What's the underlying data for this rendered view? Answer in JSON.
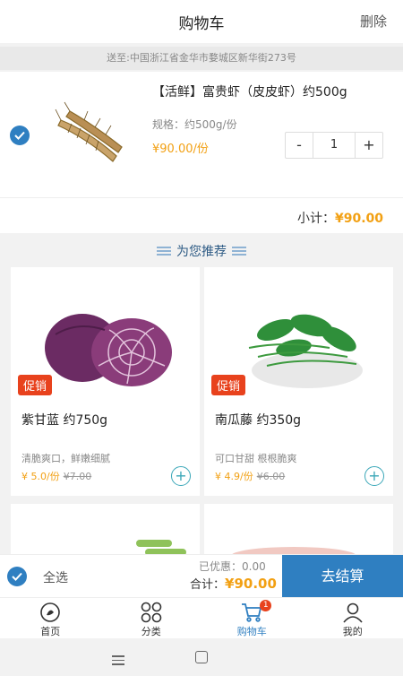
{
  "header": {
    "title": "购物车",
    "delete_label": "删除"
  },
  "address": {
    "text": "送至:中国浙江省金华市婺城区新华街273号"
  },
  "cart_item": {
    "checked": true,
    "name": "【活鲜】富贵虾（皮皮虾）约500g",
    "spec": "规格：约500g/份",
    "price": "¥90.00/份",
    "quantity": "1",
    "minus_label": "-",
    "plus_label": "+",
    "subtotal_label": "小计：",
    "subtotal_value": "¥90.00"
  },
  "recommend": {
    "title": "为您推荐",
    "products": [
      {
        "badge": "促销",
        "name": "紫甘蓝  约750g",
        "desc": "清脆爽口，鲜嫩细腻",
        "price": "¥ 5.0/份",
        "old_price": "¥7.00",
        "add_label": "+"
      },
      {
        "badge": "促销",
        "name": "南瓜藤 约350g",
        "desc": "可口甘甜 根根脆爽",
        "price": "¥ 4.9/份",
        "old_price": "¥6.00",
        "add_label": "+"
      }
    ]
  },
  "bottom_bar": {
    "select_all_label": "全选",
    "discount_text": "已优惠：0.00",
    "total_label": "合计：",
    "total_value": "¥90.00",
    "checkout_label": "去结算"
  },
  "tabbar": {
    "items": [
      {
        "label": "首页",
        "icon": "home-icon"
      },
      {
        "label": "分类",
        "icon": "category-icon"
      },
      {
        "label": "购物车",
        "icon": "cart-icon",
        "badge": "1"
      },
      {
        "label": "我的",
        "icon": "profile-icon"
      }
    ]
  },
  "colors": {
    "accent": "#2f7fc1",
    "price": "#f2a013",
    "promo": "#e8421d"
  }
}
